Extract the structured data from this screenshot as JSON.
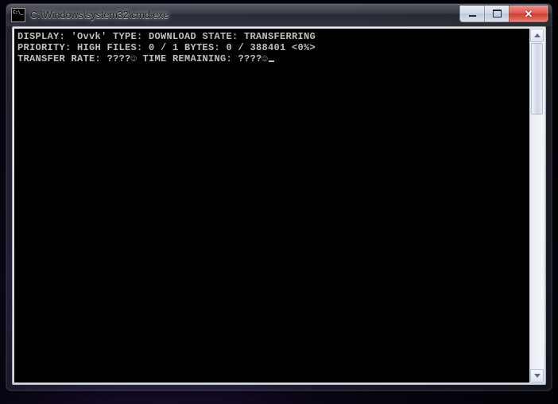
{
  "window": {
    "title": "C:\\Windows\\system32\\cmd.exe"
  },
  "console": {
    "line1": "DISPLAY: 'Ovvk' TYPE: DOWNLOAD STATE: TRANSFERRING",
    "line2": "PRIORITY: HIGH FILES: 0 / 1 BYTES: 0 / 388401 <0%>",
    "line3": "TRANSFER RATE: ????☺ TIME REMAINING: ????☺"
  }
}
